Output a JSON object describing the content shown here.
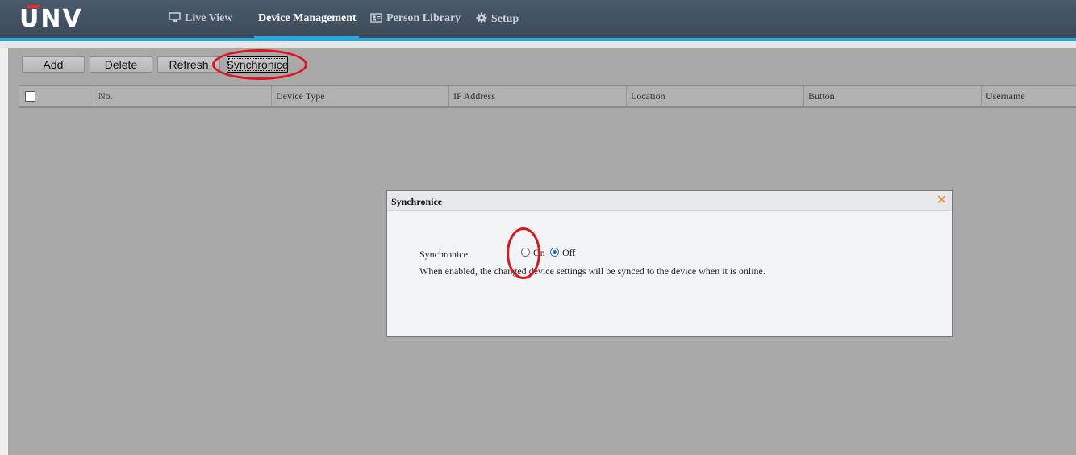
{
  "brand": {
    "logo_text": "UNV"
  },
  "nav": {
    "items": [
      {
        "label": "Live View",
        "icon": "monitor-icon",
        "active": false
      },
      {
        "label": "Device Management",
        "icon": "",
        "active": true
      },
      {
        "label": "Person Library",
        "icon": "id-card-icon",
        "active": false
      },
      {
        "label": "Setup",
        "icon": "gear-icon",
        "active": false
      }
    ]
  },
  "toolbar": {
    "add_label": "Add",
    "delete_label": "Delete",
    "refresh_label": "Refresh",
    "synchronice_label": "Synchronice"
  },
  "table": {
    "columns": [
      "No.",
      "Device Type",
      "IP Address",
      "Location",
      "Button",
      "Username"
    ],
    "rows": []
  },
  "dialog": {
    "title": "Synchronice",
    "field_label": "Synchronice",
    "options": [
      {
        "label": "On",
        "checked": false
      },
      {
        "label": "Off",
        "checked": true
      }
    ],
    "hint": "When enabled, the changed device settings will be synced to the device when it is online."
  },
  "colors": {
    "accent": "#29a7de",
    "annotation": "#e0141e",
    "close_icon": "#e5892a",
    "radio_selected": "#1f6fd6"
  }
}
